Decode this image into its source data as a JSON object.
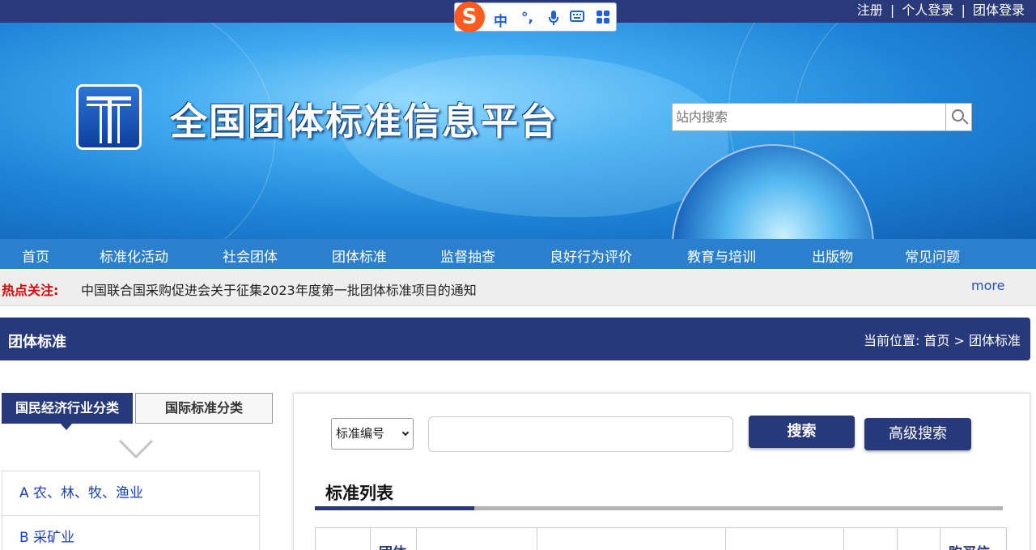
{
  "topbar": {
    "links": [
      "注册",
      "个人登录",
      "团体登录"
    ],
    "separator": "|"
  },
  "ime_toolbar": {
    "logo": "S",
    "mode": "中",
    "punct": "°,",
    "icons": [
      "microphone-icon",
      "keyboard-icon",
      "grid-menu-icon"
    ]
  },
  "header": {
    "site_title": "全国团体标准信息平台",
    "search_placeholder": "站内搜索"
  },
  "nav": {
    "items": [
      "首页",
      "标准化活动",
      "社会团体",
      "团体标准",
      "监督抽查",
      "良好行为评价",
      "教育与培训",
      "出版物",
      "常见问题"
    ]
  },
  "hot": {
    "label": "热点关注:",
    "text": "中国联合国采购促进会关于征集2023年度第一批团体标准项目的通知",
    "more": "more"
  },
  "section": {
    "title": "团体标准",
    "breadcrumb": "当前位置: 首页 > 团体标准"
  },
  "sidebar": {
    "tabs": [
      "国民经济行业分类",
      "国际标准分类"
    ],
    "categories": [
      "A 农、林、牧、渔业",
      "B 采矿业"
    ]
  },
  "search_panel": {
    "field_select": "标准编号",
    "search_button": "搜索",
    "advanced_button": "高级搜索",
    "list_title": "标准列表"
  },
  "table": {
    "headers": [
      "",
      "团体",
      "",
      "",
      "",
      "",
      "",
      "购买信"
    ]
  },
  "colors": {
    "navy": "#27397b",
    "nav_blue": "#2b7fcd",
    "hot_red": "#e00000",
    "link_blue": "#1a3fc8"
  }
}
